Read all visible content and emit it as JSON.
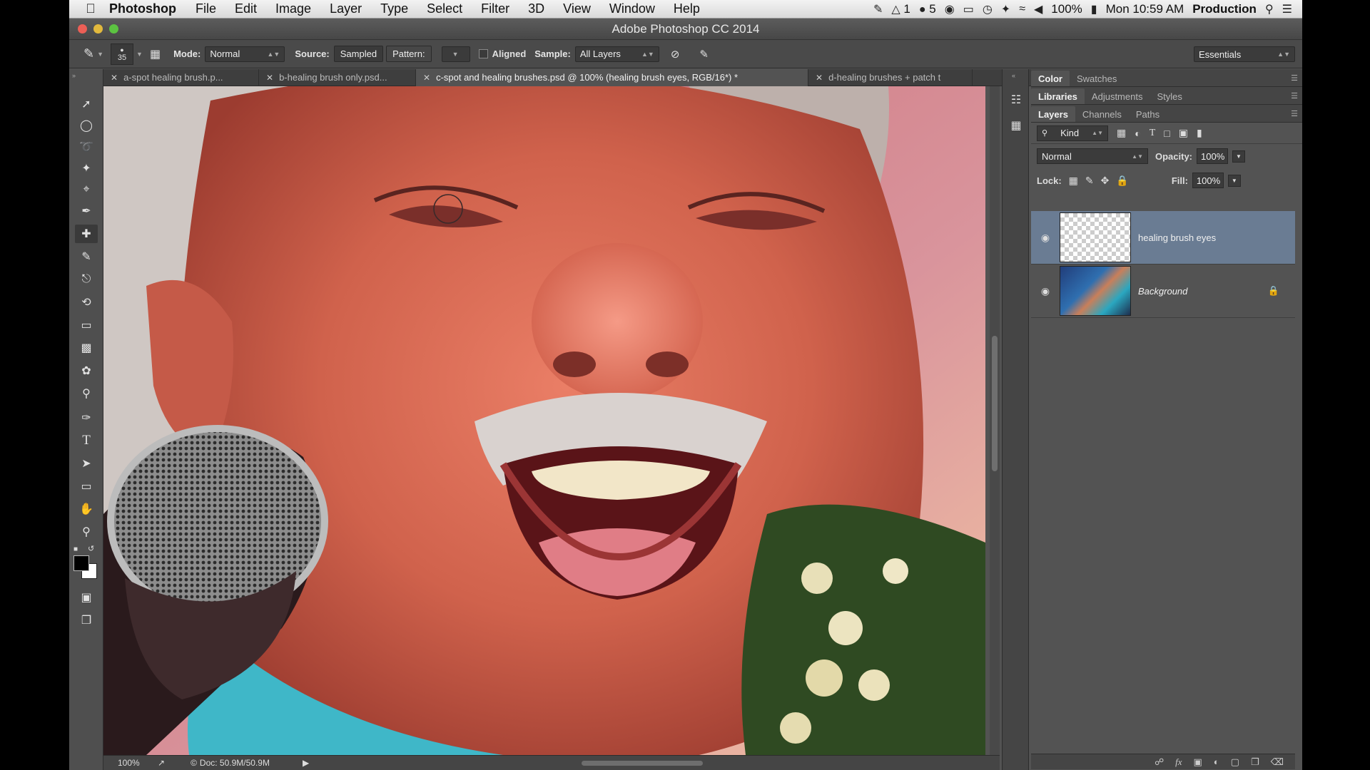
{
  "menubar": {
    "app_name": "Photoshop",
    "items": [
      "File",
      "Edit",
      "Image",
      "Layer",
      "Type",
      "Select",
      "Filter",
      "3D",
      "View",
      "Window",
      "Help"
    ],
    "status": {
      "adobe_badge": "1",
      "cc_count": "5",
      "battery": "100%",
      "clock": "Mon 10:59 AM",
      "user": "Production"
    }
  },
  "window": {
    "title": "Adobe Photoshop CC 2014"
  },
  "options": {
    "brush_size": "35",
    "mode_label": "Mode:",
    "mode_value": "Normal",
    "source_label": "Source:",
    "source_sampled": "Sampled",
    "source_pattern": "Pattern:",
    "aligned_label": "Aligned",
    "sample_label": "Sample:",
    "sample_value": "All Layers",
    "workspace": "Essentials"
  },
  "tabs": [
    {
      "label": "a-spot healing brush.p..."
    },
    {
      "label": "b-healing brush only.psd..."
    },
    {
      "label": "c-spot and healing brushes.psd @ 100% (healing brush eyes, RGB/16*) *"
    },
    {
      "label": "d-healing brushes + patch t"
    }
  ],
  "status": {
    "zoom": "100%",
    "doc": "Doc: 50.9M/50.9M"
  },
  "panels": {
    "top_tabs": [
      "Color",
      "Swatches"
    ],
    "mid_tabs": [
      "Libraries",
      "Adjustments",
      "Styles"
    ],
    "layer_tabs": [
      "Layers",
      "Channels",
      "Paths"
    ],
    "filter_kind": "Kind",
    "blend_mode": "Normal",
    "opacity_label": "Opacity:",
    "opacity_value": "100%",
    "lock_label": "Lock:",
    "fill_label": "Fill:",
    "fill_value": "100%",
    "layers": [
      {
        "name": "healing brush eyes",
        "selected": true
      },
      {
        "name": "Background",
        "selected": false
      }
    ]
  },
  "colors": {
    "selection": "#6a7c93",
    "panel_bg": "#535353",
    "close": "#ec5f56",
    "minimize": "#e2b93d",
    "zoom": "#5cc341"
  }
}
